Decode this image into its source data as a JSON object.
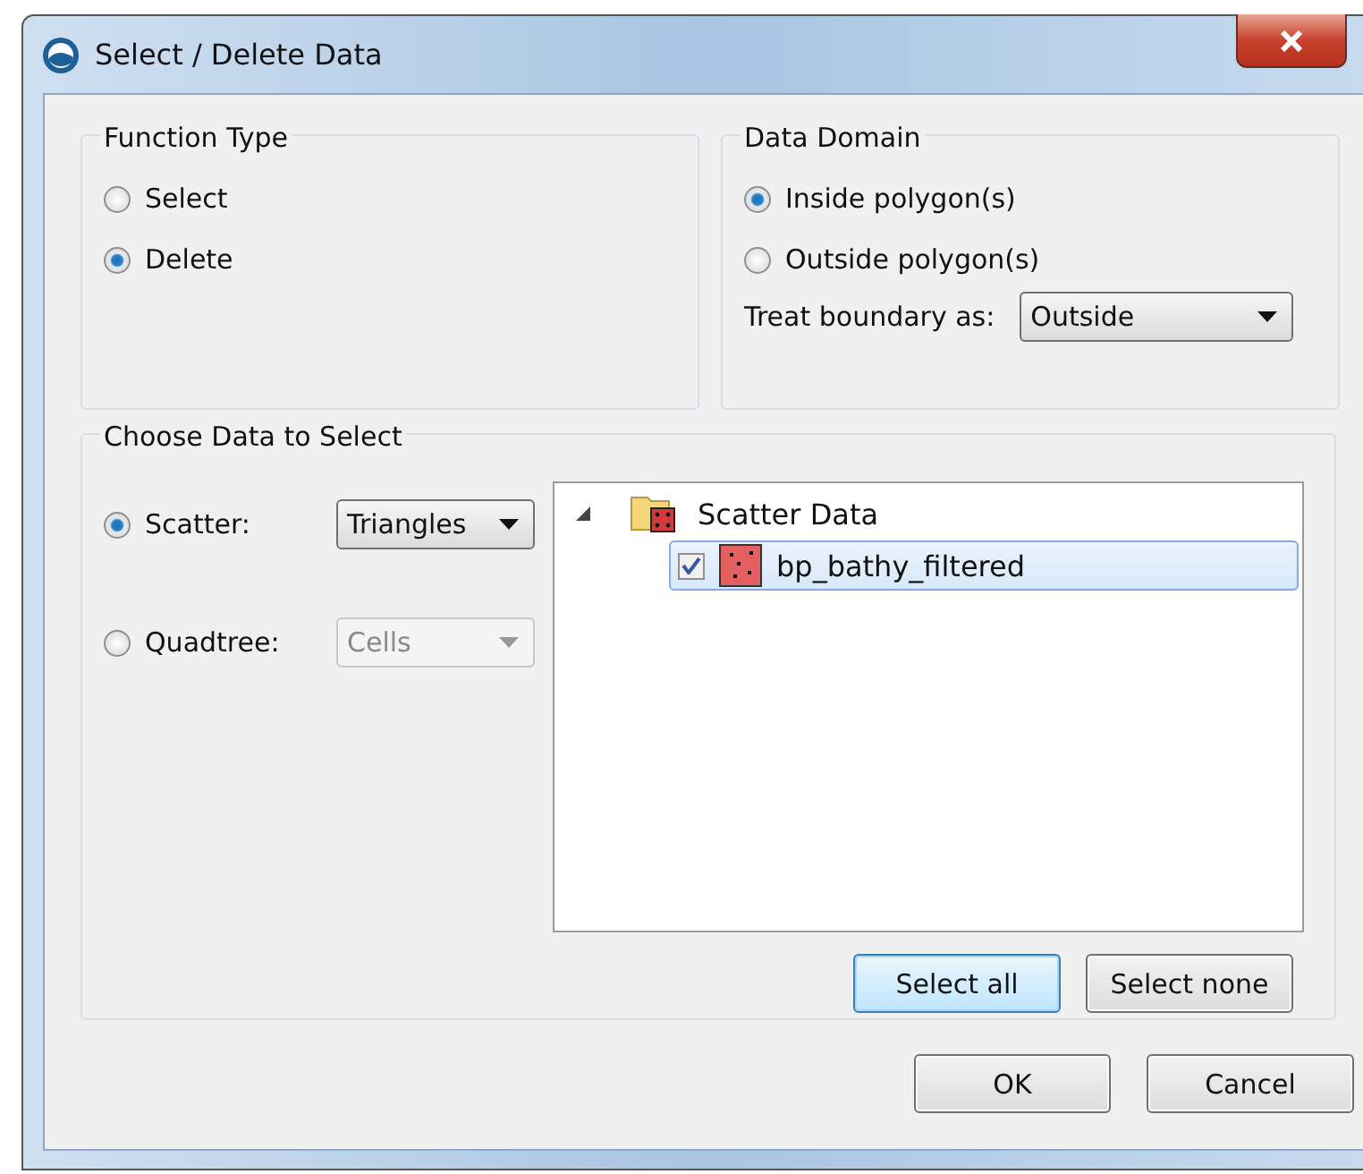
{
  "window": {
    "title": "Select / Delete Data"
  },
  "function_type": {
    "title": "Function Type",
    "options": [
      {
        "label": "Select",
        "selected": false
      },
      {
        "label": "Delete",
        "selected": true
      }
    ]
  },
  "data_domain": {
    "title": "Data Domain",
    "options": [
      {
        "label": "Inside polygon(s)",
        "selected": true
      },
      {
        "label": "Outside polygon(s)",
        "selected": false
      }
    ],
    "boundary": {
      "label": "Treat boundary as:",
      "value": "Outside"
    }
  },
  "choose_data": {
    "title": "Choose Data to Select",
    "sources": [
      {
        "label": "Scatter:",
        "selected": true,
        "value": "Triangles",
        "disabled": false
      },
      {
        "label": "Quadtree:",
        "selected": false,
        "value": "Cells",
        "disabled": true
      }
    ],
    "tree": {
      "label": "Scatter Data",
      "expanded": true,
      "children": [
        {
          "label": "bp_bathy_filtered",
          "checked": true,
          "selected": true
        }
      ]
    },
    "buttons": [
      {
        "label": "Select all",
        "focused": true
      },
      {
        "label": "Select none",
        "focused": false
      }
    ]
  },
  "buttons": [
    {
      "label": "OK"
    },
    {
      "label": "Cancel"
    }
  ]
}
